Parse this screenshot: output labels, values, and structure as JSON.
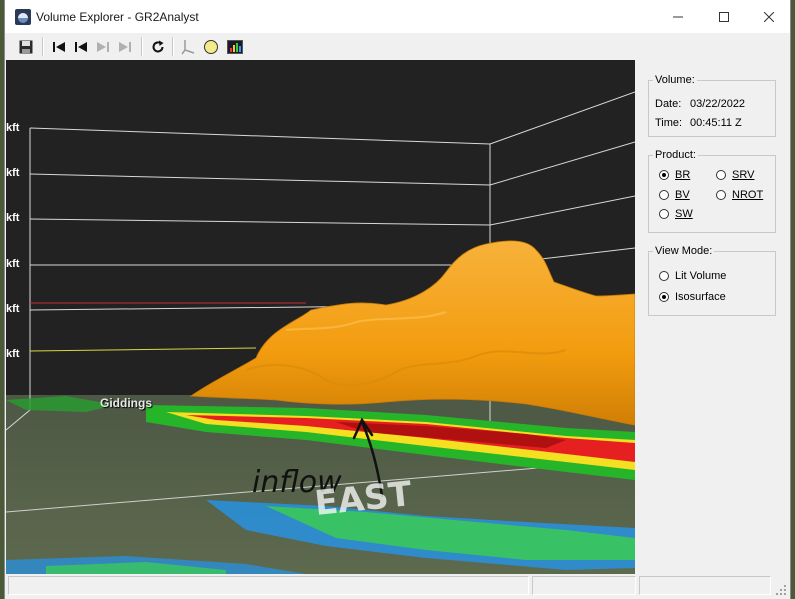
{
  "window": {
    "title": "Volume Explorer - GR2Analyst"
  },
  "toolbar": {
    "buttons": [
      {
        "name": "save-icon"
      },
      {
        "name": "skip-first-icon"
      },
      {
        "name": "step-back-icon"
      },
      {
        "name": "step-forward-icon"
      },
      {
        "name": "skip-last-icon"
      },
      {
        "name": "refresh-icon"
      },
      {
        "name": "cut-plane-icon"
      },
      {
        "name": "sphere-icon"
      },
      {
        "name": "color-table-icon"
      }
    ]
  },
  "viewport": {
    "kft_labels": [
      "kft",
      "kft",
      "kft",
      "kft",
      "kft",
      "kft"
    ],
    "city": "Giddings",
    "annotation_text": "inflow",
    "ground_text": "EAST"
  },
  "volume": {
    "title": "Volume:",
    "date_label": "Date:",
    "date_value": "03/22/2022",
    "time_label": "Time:",
    "time_value": "00:45:11 Z"
  },
  "product": {
    "title": "Product:",
    "options": [
      {
        "label": "BR",
        "selected": true
      },
      {
        "label": "SRV",
        "selected": false
      },
      {
        "label": "BV",
        "selected": false
      },
      {
        "label": "NROT",
        "selected": false
      },
      {
        "label": "SW",
        "selected": false
      }
    ]
  },
  "view_mode": {
    "title": "View Mode:",
    "options": [
      {
        "label": "Lit Volume",
        "selected": false
      },
      {
        "label": "Isosurface",
        "selected": true
      }
    ]
  },
  "colors": {
    "isosurface": "#f5a00c",
    "viewport_bg": "#222222",
    "panel_bg": "#f0f0f0"
  }
}
